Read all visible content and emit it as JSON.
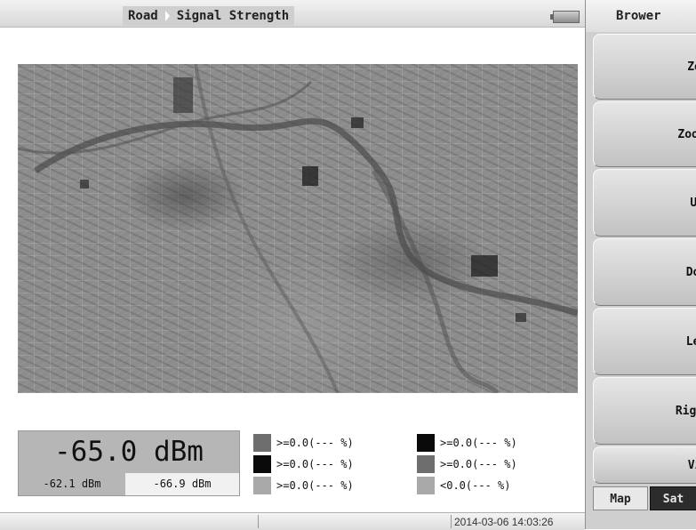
{
  "header": {
    "mode": "Road",
    "measurement": "Signal Strength"
  },
  "readout": {
    "current": "-65.0 dBm",
    "min": "-62.1 dBm",
    "max": "-66.9 dBm"
  },
  "legend": {
    "items": [
      {
        "label": ">=0.0(--- %)",
        "color": "#6e6e6e"
      },
      {
        "label": ">=0.0(--- %)",
        "color": "#0a0a0a"
      },
      {
        "label": ">=0.0(--- %)",
        "color": "#a9a9a9"
      },
      {
        "label": ">=0.0(--- %)",
        "color": "#0a0a0a"
      },
      {
        "label": ">=0.0(--- %)",
        "color": "#6e6e6e"
      },
      {
        "label": "<0.0(--- %)",
        "color": "#a9a9a9"
      }
    ]
  },
  "status": {
    "datetime": "2014-03-06 14:03:26"
  },
  "sidebar": {
    "title": "Brower",
    "buttons": [
      "Zoom In",
      "Zoom Out",
      "Up",
      "Down",
      "Left",
      "Right",
      "View"
    ],
    "toggle": {
      "map": "Map",
      "sat": "Sat",
      "selected": "Sat"
    }
  }
}
